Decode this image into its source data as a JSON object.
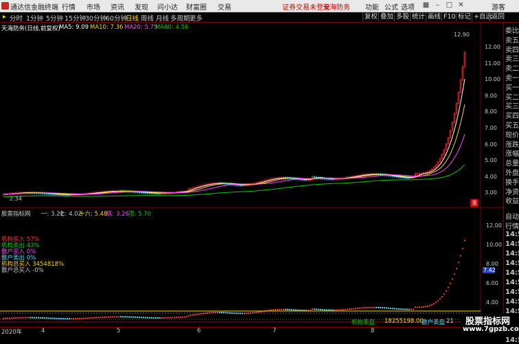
{
  "app": {
    "title": "通达信金融终端",
    "warning": "证券交易未登录",
    "user": "天海防务",
    "menu": [
      "行情",
      "市场",
      "资讯",
      "发现",
      "问小达",
      "财富圈",
      "交易"
    ],
    "right_menu": [
      "功能",
      "公式",
      "选项",
      "游客"
    ]
  },
  "toolbar": {
    "tabs": [
      "分时",
      "1分钟",
      "5分钟",
      "15分钟",
      "30分钟",
      "60分钟",
      "日线",
      "周线",
      "月线",
      "多周期",
      "更多"
    ],
    "active_tab": "日线",
    "buttons": [
      "复权",
      "叠加",
      "多股",
      "统计",
      "画线",
      "F10",
      "标记",
      "+自选",
      "返回"
    ]
  },
  "main": {
    "title": "天海防务(日线,前复权)",
    "ma": [
      {
        "label": "MA5: 9.09",
        "color": "#ffffff"
      },
      {
        "label": "MA10: 7.36",
        "color": "#ffd700"
      },
      {
        "label": "MA20: 5.75",
        "color": "#ff44ff"
      },
      {
        "label": "MA60: 4.56",
        "color": "#00d000"
      }
    ],
    "price_ticks": [
      "12.00",
      "11.00",
      "10.00",
      "9.00",
      "8.00",
      "7.00",
      "6.00",
      "5.00",
      "4.00",
      "3.00"
    ],
    "high_label": "12.90",
    "low_label": "2.34",
    "up_badge": "涨"
  },
  "indicator": {
    "title": "股票指标网",
    "legend": [
      {
        "label": "一: 3.22",
        "color": "#c8c8c8"
      },
      {
        "label": "七: 4.02",
        "color": "#c8c8c8"
      },
      {
        "label": "十六: 5.48",
        "color": "#ffd700"
      },
      {
        "label": "底: 3.26",
        "color": "#ff44ff"
      },
      {
        "label": "顶: 5.70",
        "color": "#00d000"
      }
    ],
    "annotations": [
      {
        "text": "机构买入 57%",
        "color": "#ff3030"
      },
      {
        "text": "机构卖出 43%",
        "color": "#00d000"
      },
      {
        "text": "散户买入 0%",
        "color": "#ff44ff"
      },
      {
        "text": "散户卖出 0%",
        "color": "#40e0ff"
      },
      {
        "text": "机构总买入 3454818%",
        "color": "#ffd700"
      },
      {
        "text": "散户总买入 -0%",
        "color": "#c8c8c8"
      }
    ],
    "ticks": [
      "12.00",
      "10.00",
      "8.00",
      "6.00",
      "4.00"
    ],
    "current": "7.42",
    "bottom_labels": [
      {
        "text": "机构卖盘",
        "color": "#00d000"
      },
      {
        "text": "18255198.00",
        "color": "#ffd700"
      },
      {
        "text": "散户卖盘",
        "color": "#40e0ff"
      },
      {
        "text": "21",
        "color": "#c8c8c8"
      }
    ]
  },
  "right_panel": {
    "quote": [
      "委比",
      "卖五",
      "卖四",
      "卖三",
      "卖二",
      "卖一",
      "买一",
      "买二",
      "买三",
      "买四",
      "买五",
      "现价",
      "涨跌",
      "涨幅",
      "总量",
      "外盘",
      "换手",
      "净资",
      "收益"
    ],
    "lower": [
      "自动",
      "行情"
    ],
    "times": [
      "14:5",
      "14:5",
      "14:5",
      "14:5",
      "14:5",
      "14:5",
      "14:5",
      "14:5",
      "14:5",
      "14:5",
      "14:5",
      "14:5"
    ]
  },
  "x_axis": [
    "2020年",
    "4",
    "5",
    "6",
    "7",
    "8"
  ],
  "watermark": {
    "line1": "股票指标网",
    "line2": "www.7gpzb.com"
  }
}
